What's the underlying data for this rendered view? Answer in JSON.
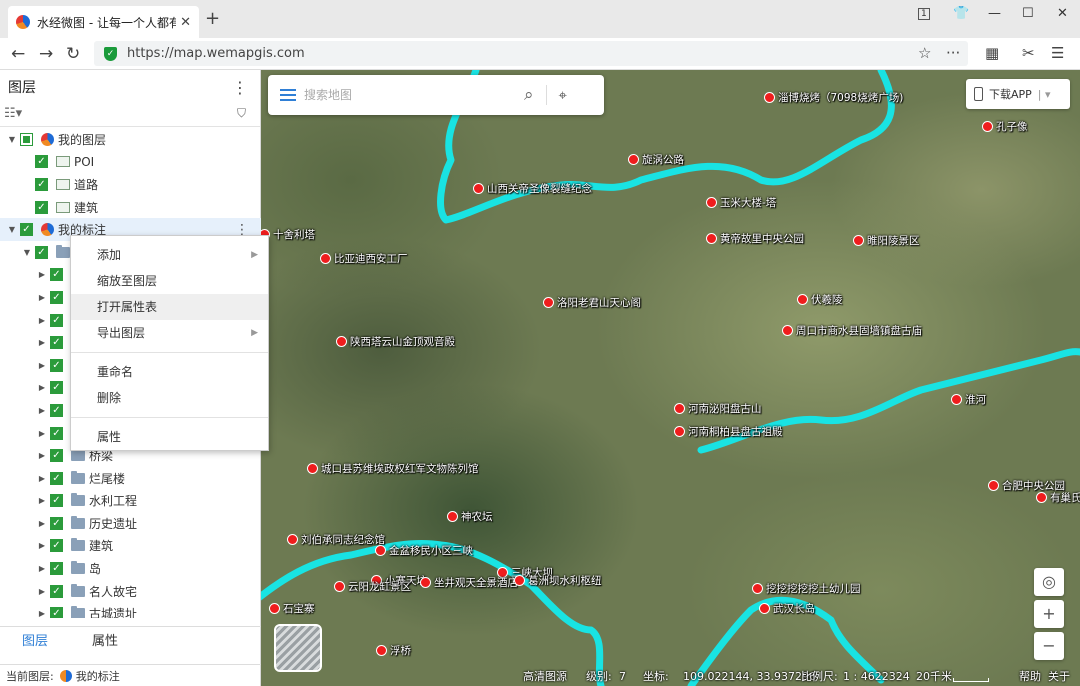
{
  "browser": {
    "tab_title": "水经微图 - 让每一个人都有自",
    "url_host": "https://map.wemapgis.com",
    "url_scheme_shown": "https://",
    "url_domain": "map.wemapgis.com"
  },
  "panel": {
    "title": "图层",
    "tree": [
      {
        "label": "我的图层",
        "level": 0,
        "caret": "down",
        "check": "partial",
        "icon": "globe-icon"
      },
      {
        "label": "POI",
        "level": 1,
        "check": "checked",
        "icon": "layer-icon"
      },
      {
        "label": "道路",
        "level": 1,
        "check": "checked",
        "icon": "layer-icon"
      },
      {
        "label": "建筑",
        "level": 1,
        "check": "checked",
        "icon": "layer-icon"
      },
      {
        "label": "我的标注",
        "level": 0,
        "caret": "down",
        "check": "checked",
        "icon": "globe-icon",
        "selected": true
      },
      {
        "label": "",
        "level": 1,
        "caret": "down",
        "check": "checked",
        "icon": "folder-icon"
      },
      {
        "label": "",
        "level": 2,
        "caret": "right",
        "check": "checked",
        "icon": "folder-icon"
      },
      {
        "label": "",
        "level": 2,
        "caret": "right",
        "check": "checked",
        "icon": "folder-icon"
      },
      {
        "label": "",
        "level": 2,
        "caret": "right",
        "check": "checked",
        "icon": "folder-icon"
      },
      {
        "label": "",
        "level": 2,
        "caret": "right",
        "check": "checked",
        "icon": "folder-icon"
      },
      {
        "label": "",
        "level": 2,
        "caret": "right",
        "check": "checked",
        "icon": "folder-icon"
      },
      {
        "label": "",
        "level": 2,
        "caret": "right",
        "check": "checked",
        "icon": "folder-icon"
      },
      {
        "label": "",
        "level": 2,
        "caret": "right",
        "check": "checked",
        "icon": "folder-icon"
      },
      {
        "label": "",
        "level": 2,
        "caret": "right",
        "check": "checked",
        "icon": "folder-icon"
      },
      {
        "label": "桥梁",
        "level": 2,
        "caret": "right",
        "check": "checked",
        "icon": "folder-icon"
      },
      {
        "label": "烂尾楼",
        "level": 2,
        "caret": "right",
        "check": "checked",
        "icon": "folder-icon"
      },
      {
        "label": "水利工程",
        "level": 2,
        "caret": "right",
        "check": "checked",
        "icon": "folder-icon"
      },
      {
        "label": "历史遗址",
        "level": 2,
        "caret": "right",
        "check": "checked",
        "icon": "folder-icon"
      },
      {
        "label": "建筑",
        "level": 2,
        "caret": "right",
        "check": "checked",
        "icon": "folder-icon"
      },
      {
        "label": "岛",
        "level": 2,
        "caret": "right",
        "check": "checked",
        "icon": "folder-icon"
      },
      {
        "label": "名人故宅",
        "level": 2,
        "caret": "right",
        "check": "checked",
        "icon": "folder-icon"
      },
      {
        "label": "古城遗址",
        "level": 2,
        "caret": "right",
        "check": "checked",
        "icon": "folder-icon"
      }
    ],
    "tabs": [
      "图层",
      "属性"
    ],
    "active_tab": "图层",
    "status_label": "当前图层:",
    "status_value": "我的标注"
  },
  "context_menu": {
    "items": [
      {
        "label": "添加",
        "submenu": true
      },
      {
        "label": "缩放至图层",
        "submenu": false
      },
      {
        "label": "打开属性表",
        "submenu": false,
        "hover": true
      },
      {
        "label": "导出图层",
        "submenu": true
      },
      {
        "sep": true
      },
      {
        "label": "重命名",
        "submenu": false
      },
      {
        "label": "删除",
        "submenu": false
      },
      {
        "sep": true
      },
      {
        "label": "属性",
        "submenu": false
      }
    ]
  },
  "map": {
    "search_placeholder": "搜索地图",
    "download_app_label": "下载APP",
    "pois": [
      {
        "label": "淄博烧烤（7098烧烤广场)"
      },
      {
        "label": "孔子像"
      },
      {
        "label": "旋涡公路"
      },
      {
        "label": "山西关帝圣像裂缝纪念"
      },
      {
        "label": "玉米大楼-塔"
      },
      {
        "label": "黄帝故里中央公园"
      },
      {
        "label": "睢阳陵景区"
      },
      {
        "label": "十舍利塔"
      },
      {
        "label": "比亚迪西安工厂"
      },
      {
        "label": "洛阳老君山天心阁"
      },
      {
        "label": "伏羲陵"
      },
      {
        "label": "周口市商水县固墙镇盘古庙"
      },
      {
        "label": "陕西塔云山金顶观音殿"
      },
      {
        "label": "河南泌阳盘古山"
      },
      {
        "label": "河南桐柏县盘古祖殿"
      },
      {
        "label": "淮河"
      },
      {
        "label": "城口县苏维埃政权红军文物陈列馆"
      },
      {
        "label": "合肥中央公园"
      },
      {
        "label": "有巢氏"
      },
      {
        "label": "神农坛"
      },
      {
        "label": "刘伯承同志纪念馆"
      },
      {
        "label": "金盆移民小区三峡"
      },
      {
        "label": "三峡大坝"
      },
      {
        "label": "小寨天坑"
      },
      {
        "label": "云阳龙缸景区"
      },
      {
        "label": "坐井观天全景酒店"
      },
      {
        "label": "葛洲坝水利枢纽"
      },
      {
        "label": "挖挖挖挖挖土幼儿园"
      },
      {
        "label": "武汉长岛"
      },
      {
        "label": "石宝寨"
      },
      {
        "label": "浮桥"
      }
    ],
    "status": {
      "source": "高清图源",
      "level_label": "级别:",
      "level": "7",
      "coord_label": "坐标:",
      "coords": "109.022144, 33.937296",
      "scale_label": "比例尺:",
      "scale": "1 : 4622324",
      "scalebar": "20千米",
      "help": "帮助",
      "close": "关于"
    }
  },
  "colors": {
    "accent": "#2f7fd6",
    "check_green": "#2b9b3b",
    "river": "#19e3e3",
    "poi_marker": "#ef1d1d"
  }
}
